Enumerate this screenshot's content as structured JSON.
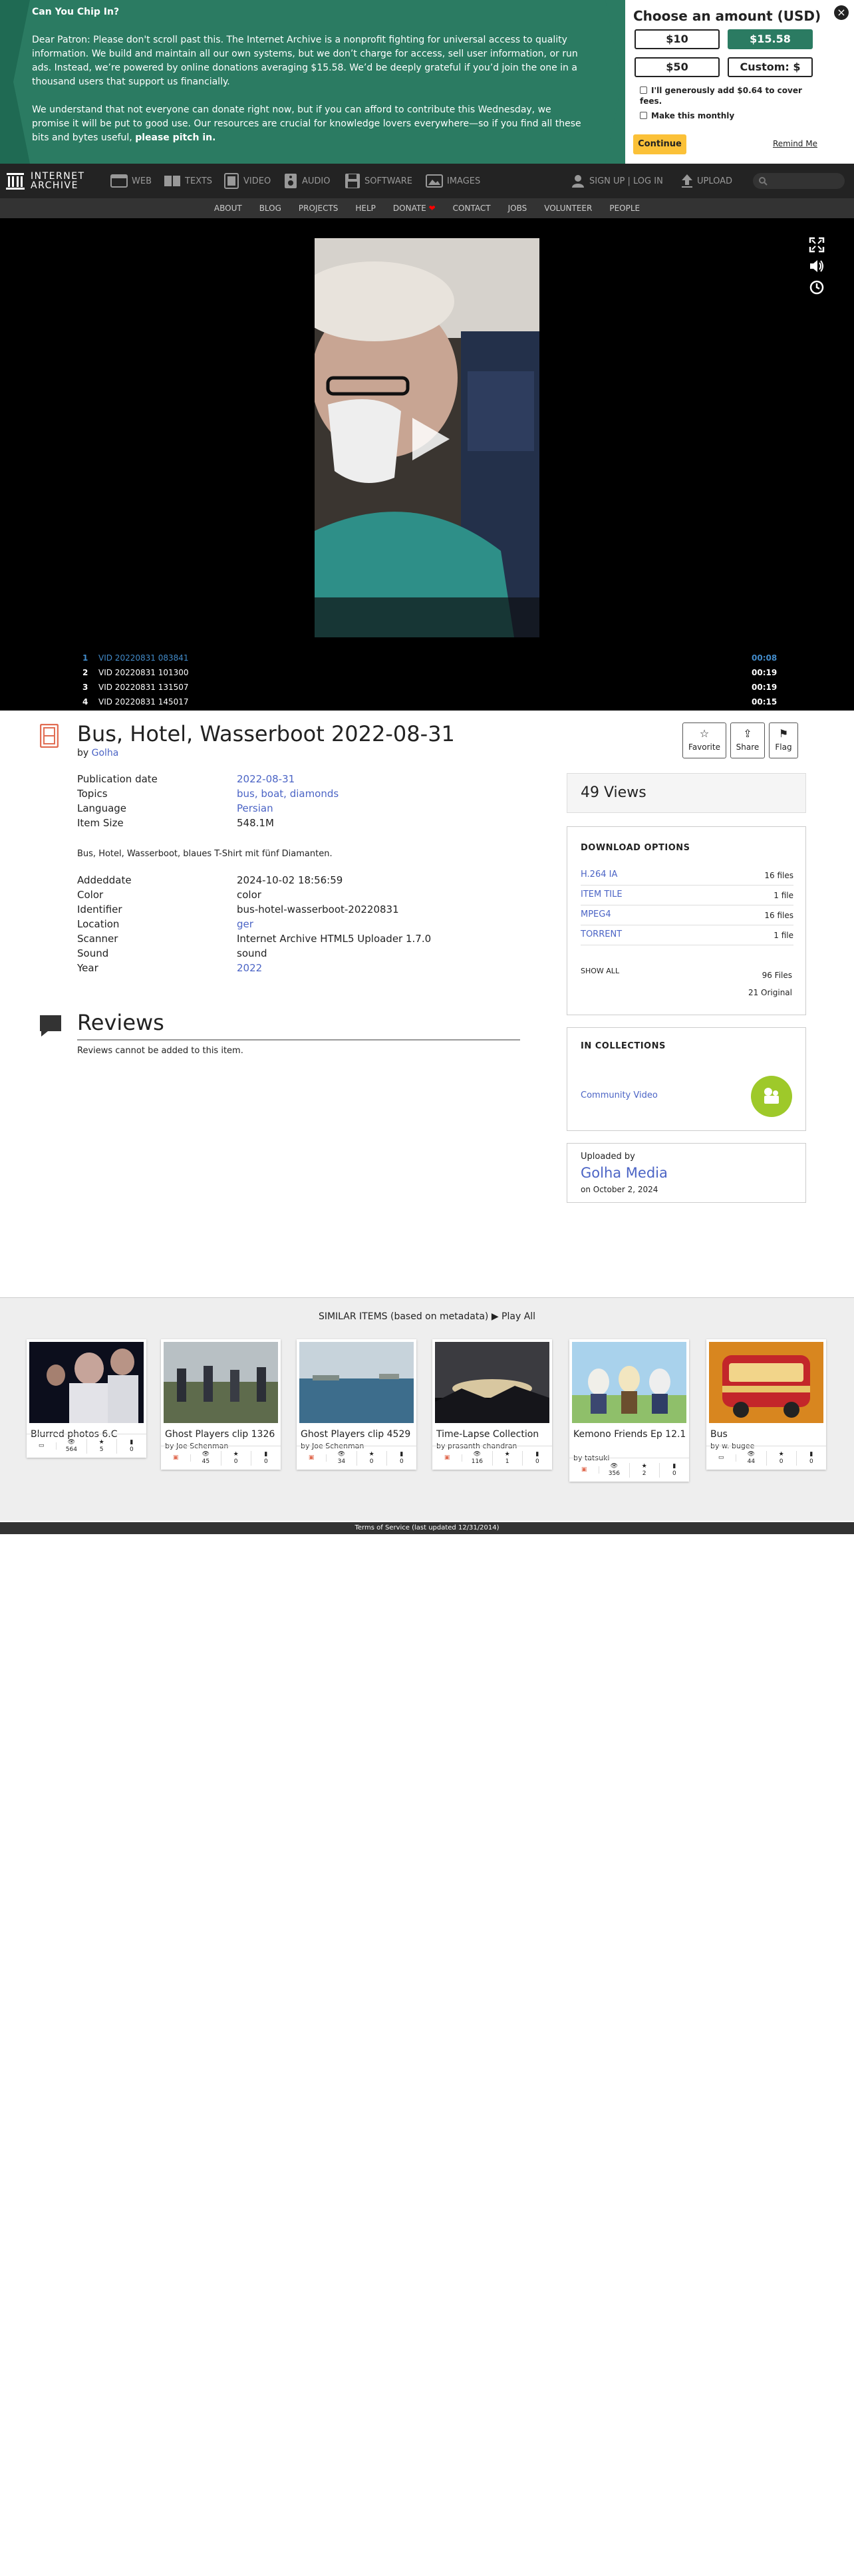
{
  "banner": {
    "title": "Can You Chip In?",
    "para1": "Dear Patron: Please don't scroll past this. The Internet Archive is a nonprofit fighting for universal access to quality information. We build and maintain all our own systems, but we don’t charge for access, sell user information, or run ads. Instead, we’re powered by online donations averaging $15.58. We’d be deeply grateful if you’d join the one in a thousand users that support us financially.",
    "para2": "We understand that not everyone can donate right now, but if you can afford to contribute this Wednesday, we promise it will be put to good use. Our resources are crucial for knowledge lovers everywhere—so if you find all these bits and bytes useful,",
    "para2_bold": "please pitch in.",
    "amount_title": "Choose an amount (USD)",
    "amounts": [
      "$10",
      "$15.58",
      "$50",
      "Custom: $"
    ],
    "cover_fees": "I'll generously add $0.64 to cover fees.",
    "monthly": "Make this monthly",
    "continue": "Continue",
    "remind": "Remind Me",
    "close": "×",
    "brand_color": "#2b7b62"
  },
  "nav": {
    "logo_line1": "INTERNET",
    "logo_line2": "ARCHIVE",
    "items": [
      "WEB",
      "TEXTS",
      "VIDEO",
      "AUDIO",
      "SOFTWARE",
      "IMAGES"
    ],
    "signup": "SIGN UP | LOG IN",
    "upload": "UPLOAD",
    "subnav": [
      "ABOUT",
      "BLOG",
      "PROJECTS",
      "HELP",
      "DONATE",
      "CONTACT",
      "JOBS",
      "VOLUNTEER",
      "PEOPLE"
    ],
    "heart": "❤"
  },
  "playlist": [
    {
      "n": "1",
      "title": "VID 20220831 083841",
      "dur": "00:08"
    },
    {
      "n": "2",
      "title": "VID 20220831 101300",
      "dur": "00:19"
    },
    {
      "n": "3",
      "title": "VID 20220831 131507",
      "dur": "00:19"
    },
    {
      "n": "4",
      "title": "VID 20220831 145017",
      "dur": "00:15"
    }
  ],
  "item": {
    "title": "Bus, Hotel, Wasserboot 2022-08-31",
    "by_label": "by",
    "author": "Golha",
    "actions": [
      "Favorite",
      "Share",
      "Flag"
    ],
    "meta1": [
      {
        "k": "Publication date",
        "v": "2022-08-31",
        "link": true
      },
      {
        "k": "Topics",
        "v": "bus, boat, diamonds",
        "link": true
      },
      {
        "k": "Language",
        "v": "Persian",
        "link": true
      },
      {
        "k": "Item Size",
        "v": "548.1M",
        "link": false
      }
    ],
    "description": "Bus, Hotel, Wasserboot, blaues T-Shirt mit fünf Diamanten.",
    "meta2": [
      {
        "k": "Addeddate",
        "v": "2024-10-02 18:56:59",
        "link": false
      },
      {
        "k": "Color",
        "v": "color",
        "link": false
      },
      {
        "k": "Identifier",
        "v": "bus-hotel-wasserboot-20220831",
        "link": false
      },
      {
        "k": "Location",
        "v": "ger",
        "link": true
      },
      {
        "k": "Scanner",
        "v": "Internet Archive HTML5 Uploader 1.7.0",
        "link": false
      },
      {
        "k": "Sound",
        "v": "sound",
        "link": false
      },
      {
        "k": "Year",
        "v": "2022",
        "link": true
      }
    ],
    "reviews_title": "Reviews",
    "reviews_note": "Reviews cannot be added to this item."
  },
  "sidebar": {
    "views": "49 Views",
    "download_title": "DOWNLOAD OPTIONS",
    "downloads": [
      {
        "name": "H.264 IA",
        "count": "16 files"
      },
      {
        "name": "ITEM TILE",
        "count": "1 file"
      },
      {
        "name": "MPEG4",
        "count": "16 files"
      },
      {
        "name": "TORRENT",
        "count": "1 file"
      }
    ],
    "show_all": "SHOW ALL",
    "total_files": "96 Files",
    "original": "21 Original",
    "collections_title": "IN COLLECTIONS",
    "collection": "Community Video",
    "uploaded_by": "Uploaded by",
    "uploader": "Golha Media",
    "uploaded_on": "on October 2, 2024"
  },
  "similar": {
    "title": "SIMILAR ITEMS (based on metadata)",
    "play_all": "Play All",
    "tiles": [
      {
        "title": "Blurred photos 6.C ",
        "by": "",
        "views": "564",
        "favs": "5",
        "reviews": "0"
      },
      {
        "title": "Ghost Players clip 1326",
        "by": "by Joe Schenman",
        "views": "45",
        "favs": "0",
        "reviews": "0"
      },
      {
        "title": "Ghost Players clip 4529",
        "by": "by Joe Schenman",
        "views": "34",
        "favs": "0",
        "reviews": "0"
      },
      {
        "title": "Time-Lapse Collection",
        "by": "by prasanth chandran",
        "views": "116",
        "favs": "1",
        "reviews": "0"
      },
      {
        "title": "Kemono Friends Ep 12.1",
        "by": "by tatsuki",
        "views": "356",
        "favs": "2",
        "reviews": "0"
      },
      {
        "title": "Bus",
        "by": "by w. bugee",
        "views": "44",
        "favs": "0",
        "reviews": "0"
      }
    ]
  },
  "footer": "Terms of Service (last updated 12/31/2014)"
}
